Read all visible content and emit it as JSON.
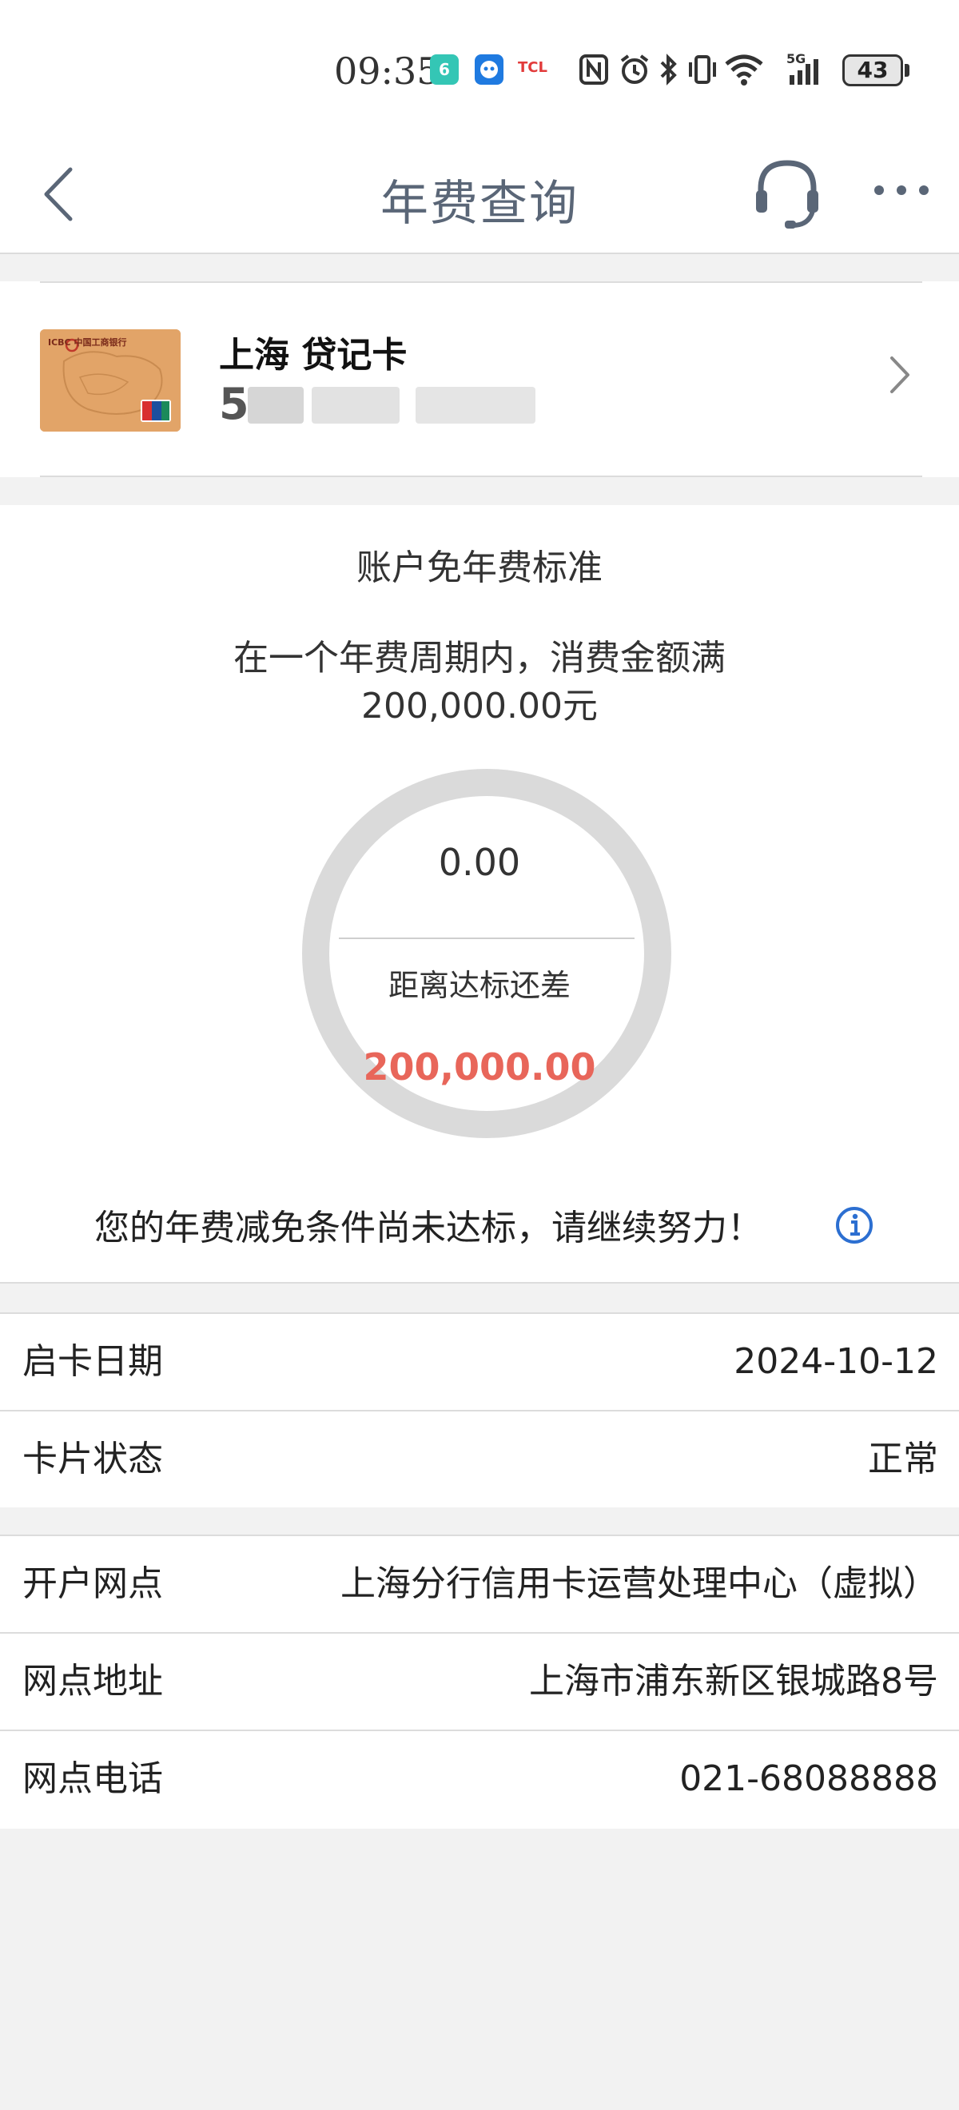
{
  "status_bar": {
    "time": "09:35",
    "battery": "43",
    "network": "5G",
    "icons": [
      "notification-app-icon",
      "chat-app-icon",
      "brand-app-icon",
      "nfc-icon",
      "alarm-icon",
      "bluetooth-icon",
      "vibrate-icon",
      "wifi-icon",
      "signal-icon",
      "battery-icon"
    ],
    "app_notif_label": "6",
    "brand_label": "TCL"
  },
  "nav": {
    "title": "年费查询",
    "icons": [
      "back-icon",
      "customer-service-icon",
      "more-icon"
    ]
  },
  "card": {
    "name": "上海 贷记卡",
    "number_visible": "5",
    "thumb_bank_label": "ICBC 中国工商银行",
    "thumb_network_label": "UnionPay"
  },
  "standard": {
    "title": "账户免年费标准",
    "desc_line1": "在一个年费周期内，消费金额满",
    "desc_line2": "200,000.00元",
    "spent": "0.00",
    "remain_label": "距离达标还差",
    "remain_value": "200,000.00",
    "progress_fraction": 0,
    "message": "您的年费减免条件尚未达标，请继续努力！",
    "remain_color": "#e8665a"
  },
  "details_group1": [
    {
      "label": "启卡日期",
      "value": "2024-10-12"
    },
    {
      "label": "卡片状态",
      "value": "正常"
    }
  ],
  "details_group2": [
    {
      "label": "开户网点",
      "value": "上海分行信用卡运营处理中心（虚拟）"
    },
    {
      "label": "网点地址",
      "value": "上海市浦东新区银城路8号"
    },
    {
      "label": "网点电话",
      "value": "021-68088888"
    }
  ],
  "colors": {
    "nav_title": "#5a6677",
    "info_icon": "#2c6fd1",
    "ring": "#dadada",
    "background": "#f2f2f2"
  }
}
